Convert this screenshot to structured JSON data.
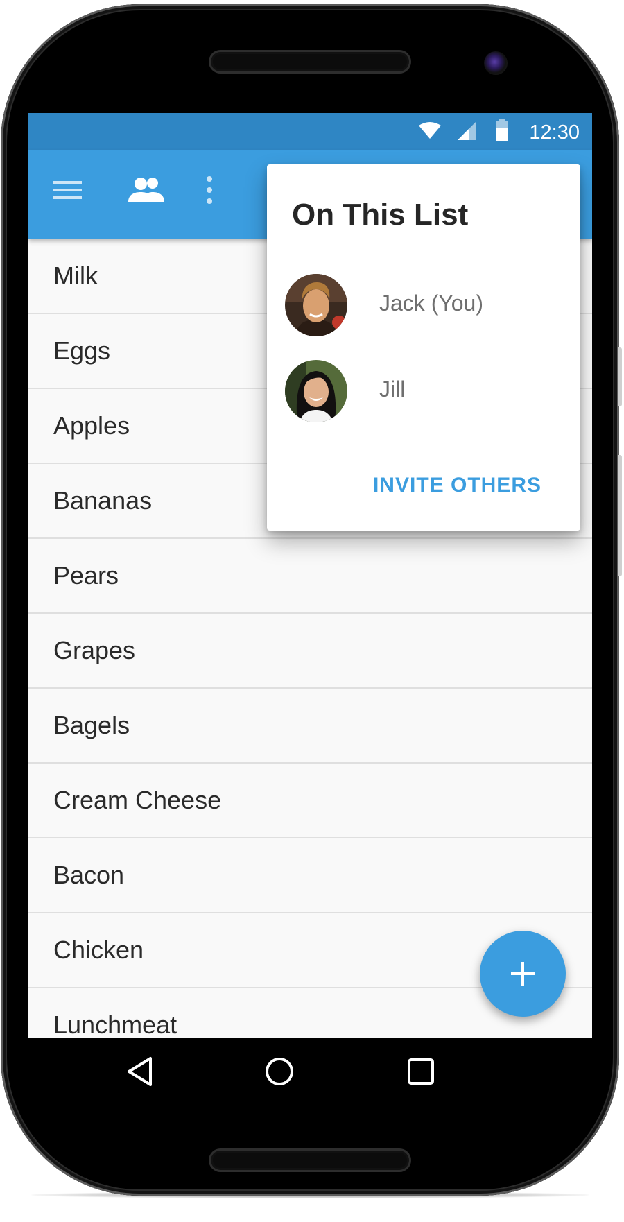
{
  "status_bar": {
    "time": "12:30",
    "icons": [
      "wifi-icon",
      "cell-signal-icon",
      "battery-icon"
    ]
  },
  "app_bar": {
    "icons": [
      "menu-icon",
      "people-icon",
      "more-vert-icon"
    ]
  },
  "popup": {
    "title": "On This List",
    "members": [
      {
        "name": "Jack (You)",
        "avatar": "avatar-jack"
      },
      {
        "name": "Jill",
        "avatar": "avatar-jill"
      }
    ],
    "invite_label": "INVITE OTHERS"
  },
  "list": {
    "items": [
      "Milk",
      "Eggs",
      "Apples",
      "Bananas",
      "Pears",
      "Grapes",
      "Bagels",
      "Cream Cheese",
      "Bacon",
      "Chicken",
      "Lunchmeat"
    ]
  },
  "fab": {
    "icon": "add-icon"
  },
  "nav_bar": {
    "icons": [
      "back-icon",
      "home-icon",
      "recents-icon"
    ]
  },
  "colors": {
    "status_bar": "#2f86c4",
    "app_bar": "#3b9ddf",
    "accent": "#3b9ddf",
    "list_background": "#f9f9f9",
    "divider": "#dfdfdf"
  }
}
